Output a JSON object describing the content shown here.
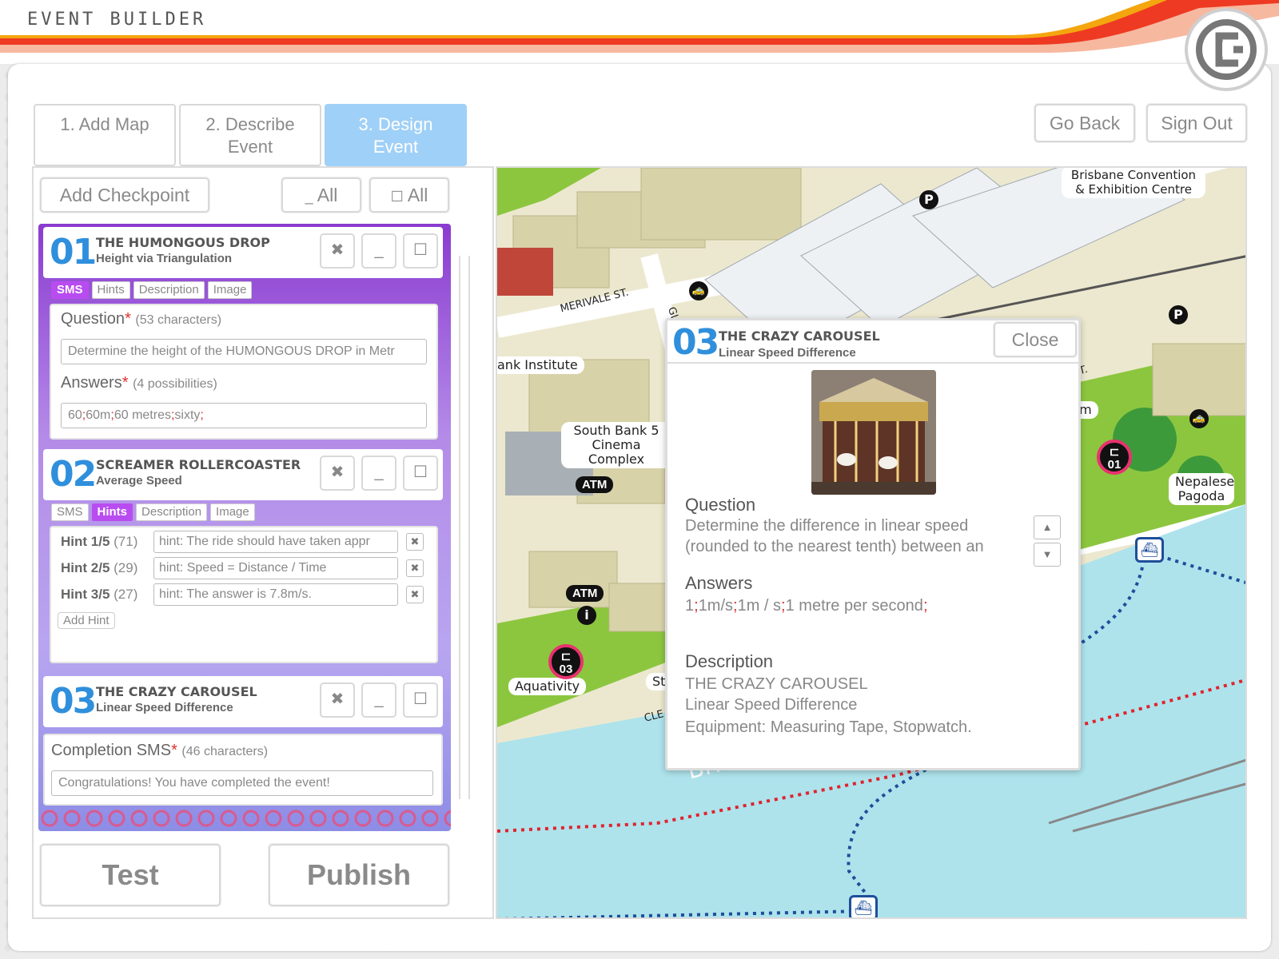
{
  "app_title": "EVENT BUILDER",
  "colors": {
    "accent": "#9fd0f7",
    "required": "#e03030",
    "number": "#2f8fdc",
    "tab_active": "#b84cf0"
  },
  "steps": [
    {
      "label": "1. Add Map"
    },
    {
      "label": "2. Describe Event"
    },
    {
      "label": "3. Design Event",
      "active": true
    }
  ],
  "top_buttons": {
    "go_back": "Go Back",
    "sign_out": "Sign Out"
  },
  "toolbar": {
    "add_checkpoint": "Add Checkpoint",
    "collapse_all": "All",
    "expand_all": "All"
  },
  "checkpoints": [
    {
      "number": "01",
      "title": "THE HUMONGOUS DROP",
      "subtitle": "Height via Triangulation",
      "tabs": [
        "SMS",
        "Hints",
        "Description",
        "Image"
      ],
      "active_tab": "SMS",
      "question_label": "Question",
      "question_count": "(53 characters)",
      "question_value": "Determine the height of the HUMONGOUS DROP in Metr",
      "answers_label": "Answers",
      "answers_count": "(4 possibilities)",
      "answers": [
        "60",
        "60m",
        "60 metres",
        "sixty"
      ]
    },
    {
      "number": "02",
      "title": "SCREAMER ROLLERCOASTER",
      "subtitle": "Average Speed",
      "tabs": [
        "SMS",
        "Hints",
        "Description",
        "Image"
      ],
      "active_tab": "Hints",
      "hints": [
        {
          "label": "Hint 1/5",
          "count": "(71)",
          "value": "hint: The ride should have taken appr"
        },
        {
          "label": "Hint 2/5",
          "count": "(29)",
          "value": "hint: Speed = Distance / Time"
        },
        {
          "label": "Hint 3/5",
          "count": "(27)",
          "value": "hint: The answer is 7.8m/s."
        }
      ],
      "add_hint": "Add Hint"
    },
    {
      "number": "03",
      "title": "THE CRAZY CAROUSEL",
      "subtitle": "Linear Speed Difference"
    }
  ],
  "completion": {
    "label": "Completion SMS",
    "count": "(46 characters)",
    "value": "Congratulations! You have completed the event!"
  },
  "bottom_buttons": {
    "test": "Test",
    "publish": "Publish"
  },
  "map": {
    "labels": {
      "convention": "Brisbane Convention & Exhibition Centre",
      "bank_institute": "ank Institute",
      "cinema": "South Bank 5 Cinema Complex",
      "nepalese": "Nepalese Pagoda",
      "aquativity": "Aquativity",
      "museum": "um",
      "merivale": "MERIVALE ST.",
      "glenelg": "GLE",
      "st": "ST.",
      "clem": "CLE",
      "stanley": "St",
      "river": "Bri"
    },
    "atm_labels": [
      "ATM",
      "ATM"
    ],
    "markers": [
      "01",
      "03"
    ]
  },
  "popup": {
    "number": "03",
    "title": "THE CRAZY CAROUSEL",
    "subtitle": "Linear Speed Difference",
    "close": "Close",
    "question_heading": "Question",
    "question_line1": "Determine the difference in linear speed",
    "question_line2": "(rounded to the nearest tenth) between an",
    "answers_heading": "Answers",
    "answers": [
      "1",
      "1m/s",
      "1m / s",
      "1 metre per second"
    ],
    "description_heading": "Description",
    "description_line1": "THE CRAZY CAROUSEL",
    "description_line2": "Linear Speed Difference",
    "description_line3": "Equipment: Measuring Tape, Stopwatch."
  }
}
